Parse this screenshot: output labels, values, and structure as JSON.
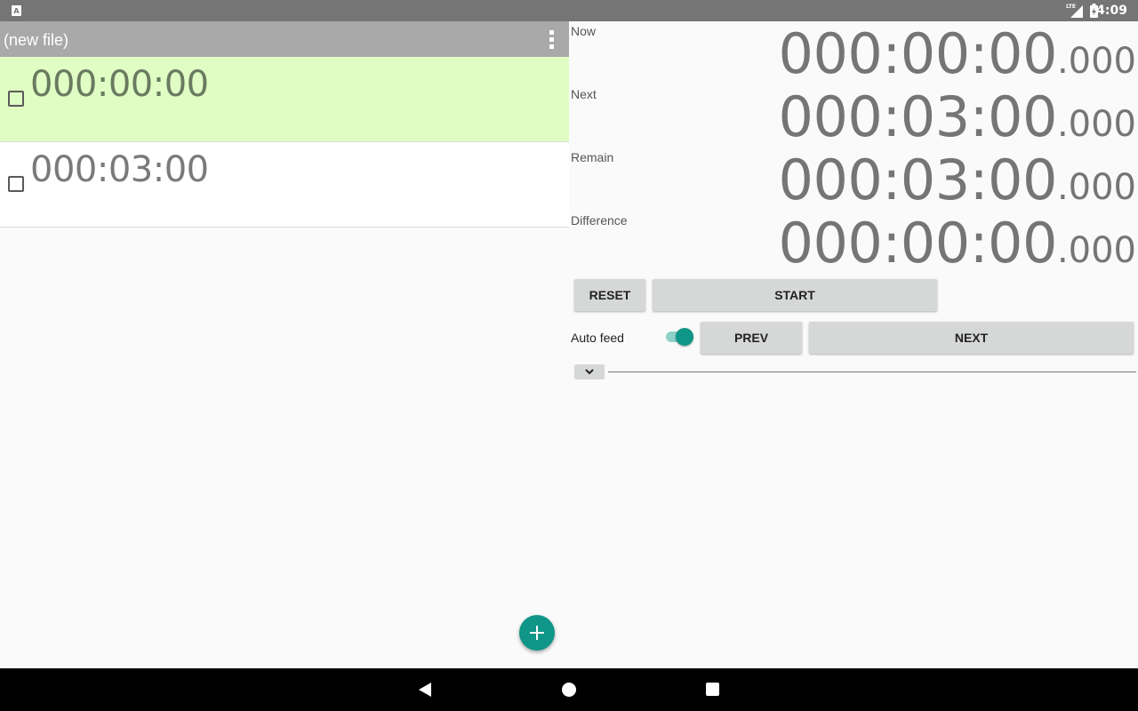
{
  "status_bar": {
    "app_icon_letter": "A",
    "network_label": "LTE",
    "time": "4:09",
    "icons": [
      "app-notification-icon",
      "signal-icon",
      "battery-charging-icon"
    ]
  },
  "app_bar": {
    "title": "(new file)",
    "menu_icon": "overflow-menu-icon"
  },
  "timer_list": [
    {
      "time": "000:00:00",
      "checked": false,
      "highlighted": true
    },
    {
      "time": "000:03:00",
      "checked": false,
      "highlighted": false
    }
  ],
  "fab": {
    "icon": "plus-icon"
  },
  "readouts": {
    "now": {
      "label": "Now",
      "main": "000:00:00",
      "ms": ".000"
    },
    "next": {
      "label": "Next",
      "main": "000:03:00",
      "ms": ".000"
    },
    "remain": {
      "label": "Remain",
      "main": "000:03:00",
      "ms": ".000"
    },
    "difference": {
      "label": "Difference",
      "main": "000:00:00",
      "ms": ".000"
    }
  },
  "controls": {
    "reset_label": "RESET",
    "start_label": "START",
    "auto_feed_label": "Auto feed",
    "auto_feed_on": true,
    "prev_label": "PREV",
    "next_label": "NEXT",
    "expand_icon": "chevron-down-icon"
  },
  "nav_bar": {
    "icons": [
      "back-icon",
      "home-icon",
      "recents-icon"
    ]
  },
  "colors": {
    "accent": "#0f9688",
    "app_bar": "#a9a9a9",
    "status_bar": "#757575",
    "highlight_row": "#e0fec4",
    "button": "#d6d7d7"
  }
}
